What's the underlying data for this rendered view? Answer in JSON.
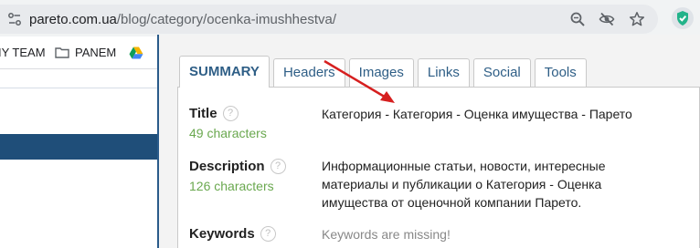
{
  "browser": {
    "url_host": "pareto.com.ua",
    "url_path": "/blog/category/ocenka-imushhestva/",
    "bookmarks": [
      {
        "label": "IY TEAM"
      },
      {
        "label": "PANEM"
      }
    ]
  },
  "popup": {
    "tabs": [
      {
        "label": "SUMMARY",
        "active": true
      },
      {
        "label": "Headers",
        "active": false
      },
      {
        "label": "Images",
        "active": false
      },
      {
        "label": "Links",
        "active": false
      },
      {
        "label": "Social",
        "active": false
      },
      {
        "label": "Tools",
        "active": false
      }
    ],
    "rows": {
      "title": {
        "label": "Title",
        "count": "49 characters",
        "value": "Категория - Категория - Оценка имущества - Парето"
      },
      "description": {
        "label": "Description",
        "count": "126 characters",
        "lines": [
          "Информационные статьи, новости, интересные",
          "материалы и публикации о Категория - Оценка",
          "имущества от оценочной компании Парето."
        ]
      },
      "keywords": {
        "label": "Keywords",
        "value": "Keywords are missing!"
      }
    },
    "help_glyph": "?"
  },
  "colors": {
    "accent": "#2e5e86",
    "count_green": "#6aa84f",
    "arrow_red": "#d61f1f",
    "bg_band": "#1f4e79"
  }
}
